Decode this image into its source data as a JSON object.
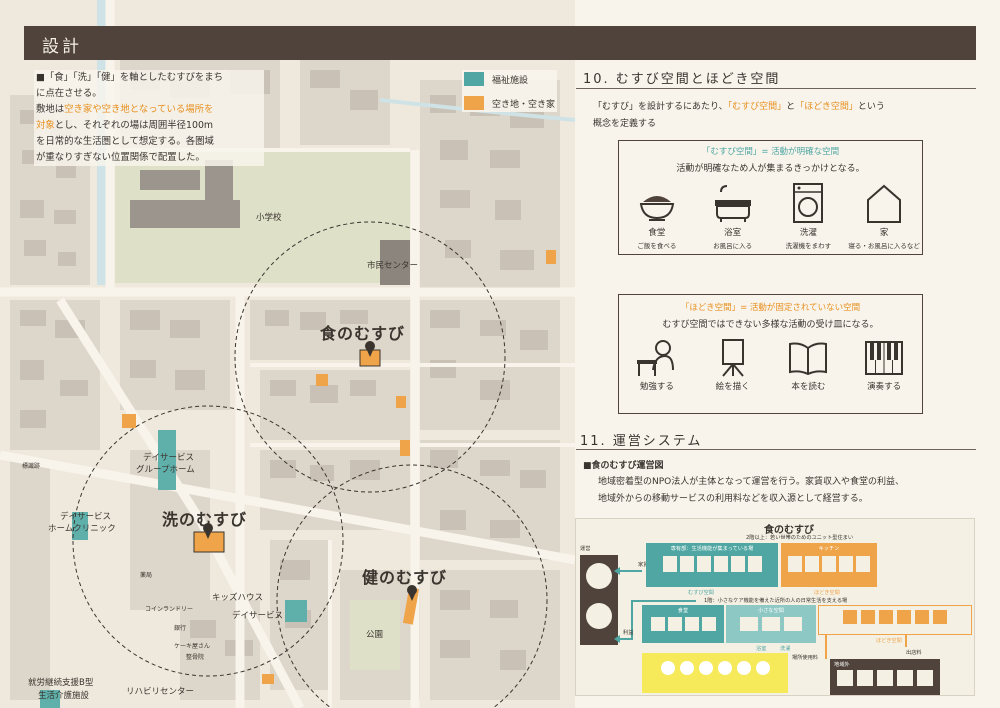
{
  "header": {
    "title": "設計"
  },
  "intro": {
    "line1": "■「食」「洗」「健」を軸としたむすびをまち",
    "line2": "に点在させる。",
    "line3_a": "敷地は",
    "line3_hl": "空き家や空き地となっている場所を",
    "line4_hl": "対象",
    "line4_b": "とし、それぞれの場は周囲半径100m",
    "line5": "を日常的な生活圏として想定する。各圏域",
    "line6": "が重なりすぎない位置関係で配置した。"
  },
  "legend": [
    {
      "label": "福祉施設",
      "color": "#4fa6a2"
    },
    {
      "label": "空き地・空き家",
      "color": "#f0a44a"
    }
  ],
  "map": {
    "labels": {
      "school": "小学校",
      "civic": "市民センター",
      "shoku": "食のむすび",
      "sen": "洗のむすび",
      "ken": "健のむすび",
      "dayservice_gh_1": "デイサービス",
      "dayservice_gh_2": "グループホーム",
      "dayservice_clinic_1": "デイサービス",
      "dayservice_clinic_2": "ホームクリニック",
      "kids_1": "キッズハウス",
      "kids_2": "デイサービス",
      "park": "公園",
      "support_1": "就労継続支援B型",
      "support_2": "生活介護施設",
      "rehab": "リハビリセンター",
      "small_1": "標識跡",
      "small_2": "薬局",
      "small_3": "コインランドリー",
      "small_4": "銀行",
      "small_5": "ケーキ屋さん",
      "small_6": "整骨院"
    }
  },
  "section10": {
    "title": "10. むすび空間とほどき空間",
    "desc1_a": "「むすび」を設計するにあたり、",
    "desc1_hl1": "「むすび空間」",
    "desc1_b": "と",
    "desc1_hl2": "「ほどき空間」",
    "desc1_c": "という",
    "desc2": "概念を定義する",
    "musubi_box": {
      "title": "「むすび空間」= 活動が明確な空間",
      "subtitle": "活動が明確なため人が集まるきっかけとなる。",
      "items": [
        {
          "icon": "rice-bowl-icon",
          "label": "食堂",
          "sub": "ご飯を食べる"
        },
        {
          "icon": "bathtub-icon",
          "label": "浴室",
          "sub": "お風呂に入る"
        },
        {
          "icon": "washing-machine-icon",
          "label": "洗濯",
          "sub": "洗濯機をまわす"
        },
        {
          "icon": "house-icon",
          "label": "家",
          "sub": "寝る・お風呂に入るなど"
        }
      ]
    },
    "hodoki_box": {
      "title": "「ほどき空間」= 活動が固定されていない空間",
      "subtitle": "むすび空間ではできない多様な活動の受け皿になる。",
      "items": [
        {
          "icon": "study-icon",
          "label": "勉強する"
        },
        {
          "icon": "easel-icon",
          "label": "絵を描く"
        },
        {
          "icon": "book-icon",
          "label": "本を読む"
        },
        {
          "icon": "piano-icon",
          "label": "演奏する"
        }
      ]
    }
  },
  "section11": {
    "title": "11. 運営システム",
    "subhead": "■食のむすび運営図",
    "desc1": "地域密着型のNPO法人が主体となって運営を行う。家賃収入や食堂の利益、",
    "desc2": "地域外からの移動サービスの利用料などを収入源として経営する。",
    "diagram": {
      "title": "食のむすび",
      "floor2": "2階以上：若い世帯のためのユニット型住まい",
      "common": "専有部：生活機能が集まっている場",
      "kitchen_label": "キッチン",
      "floor1": "1階：小さなケア機能を備えた近所の人の日常生活を支える場",
      "unei": "運営",
      "yachin": "家賃",
      "rieki": "利益",
      "shokudo": "食堂",
      "small_space": "小さな空間",
      "bathroom": "浴室",
      "laundry": "洗濯",
      "musubi_kukan": "むすび空間",
      "hodoki_kukan": "ほどき空間",
      "hodoki_kukan2": "ほどき空間",
      "riyoryo": "場所使用料",
      "shushi": "出店料",
      "chiikigai": "地域外"
    }
  }
}
